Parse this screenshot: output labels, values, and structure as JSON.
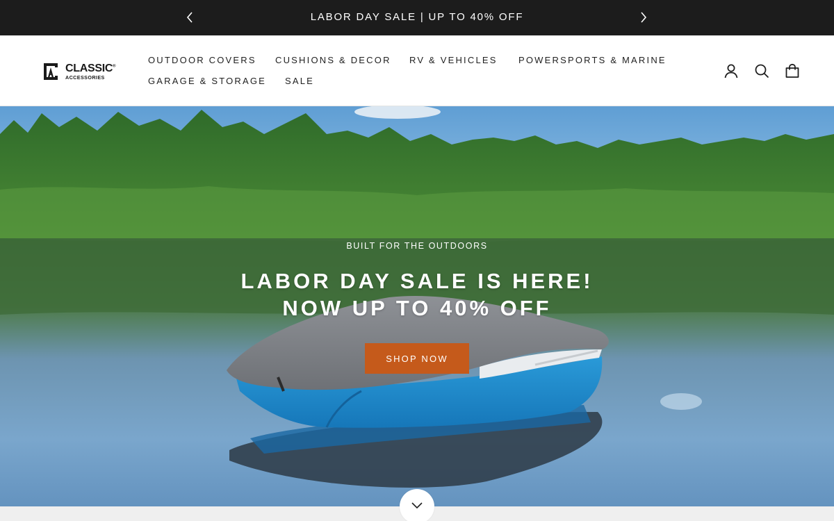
{
  "announcement": {
    "text": "LABOR DAY SALE | UP TO 40% OFF",
    "prev_icon": "chevron-left-icon",
    "next_icon": "chevron-right-icon"
  },
  "header": {
    "logo": {
      "main": "CLASSIC",
      "sub": "ACCESSORIES",
      "mark": "®"
    },
    "nav": [
      {
        "label": "OUTDOOR COVERS"
      },
      {
        "label": "CUSHIONS & DECOR"
      },
      {
        "label": "RV & VEHICLES"
      },
      {
        "label": "POWERSPORTS & MARINE"
      },
      {
        "label": "GARAGE & STORAGE"
      },
      {
        "label": "SALE"
      }
    ],
    "icons": [
      "account-icon",
      "search-icon",
      "cart-icon"
    ]
  },
  "hero": {
    "eyebrow": "BUILT FOR THE OUTDOORS",
    "title_line1": "LABOR DAY SALE IS HERE!",
    "title_line2": "NOW UP TO 40% OFF",
    "cta": "SHOP NOW",
    "scroll_icon": "chevron-down-icon"
  },
  "colors": {
    "announcement_bg": "#1c1c1c",
    "cta_bg": "#c55a1b",
    "text_dark": "#1f1f1f"
  }
}
